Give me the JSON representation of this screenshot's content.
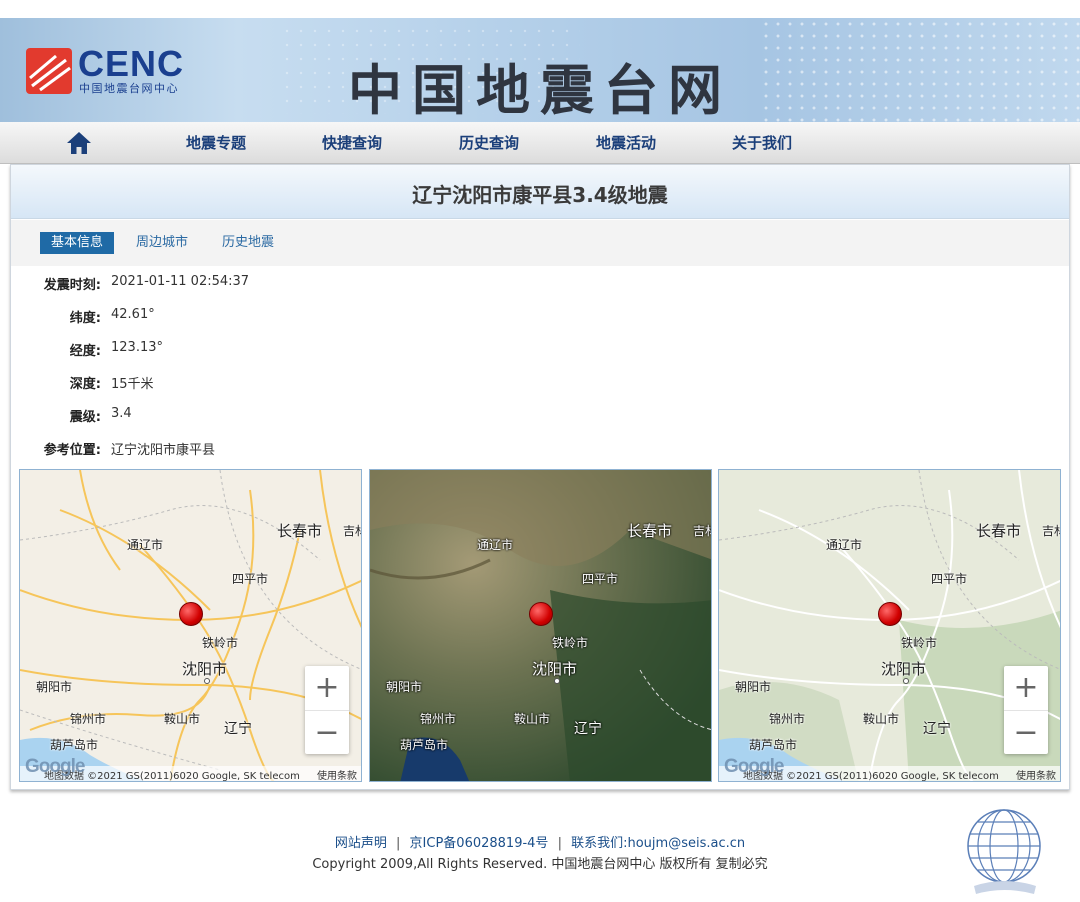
{
  "brand": {
    "logo_text": "CENC",
    "logo_subtitle": "中国地震台网中心",
    "site_title": "中国地震台网"
  },
  "nav": {
    "home_icon": "home-icon",
    "items": [
      "地震专题",
      "快捷查询",
      "历史查询",
      "地震活动",
      "关于我们"
    ]
  },
  "event": {
    "title": "辽宁沈阳市康平县3.4级地震"
  },
  "tabs": {
    "items": [
      "基本信息",
      "周边城市",
      "历史地震"
    ],
    "active": "基本信息"
  },
  "details": [
    {
      "label": "发震时刻:",
      "value": "2021-01-11 02:54:37"
    },
    {
      "label": "纬度:",
      "value": "42.61°"
    },
    {
      "label": "经度:",
      "value": "123.13°"
    },
    {
      "label": "深度:",
      "value": "15千米"
    },
    {
      "label": "震级:",
      "value": "3.4"
    },
    {
      "label": "参考位置:",
      "value": "辽宁沈阳市康平县"
    }
  ],
  "maps": {
    "cities": {
      "changchun": "长春市",
      "jilin": "吉林",
      "tongliao": "通辽市",
      "siping": "四平市",
      "tieling": "铁岭市",
      "shenyang": "沈阳市",
      "chaoyang": "朝阳市",
      "jinzhou": "锦州市",
      "anshan": "鞍山市",
      "liaoning": "辽宁",
      "huludao": "葫芦岛市"
    },
    "zoom_in": "+",
    "zoom_out": "−",
    "google_logo": "Google",
    "attribution": "地图数据 ©2021 GS(2011)6020 Google, SK telecom",
    "terms": "使用条款",
    "types": [
      "road",
      "satellite",
      "terrain"
    ]
  },
  "footer": {
    "links": [
      "网站声明",
      "京ICP备06028819-4号",
      "联系我们:houjm@seis.ac.cn"
    ],
    "separator": "|",
    "copyright": "Copyright 2009,All Rights Reserved. 中国地震台网中心 版权所有 复制必究"
  },
  "colors": {
    "nav_text": "#1b3f7a",
    "tab_active_bg": "#1f6aa6",
    "quake_marker": "#d10000",
    "header_bg": "#b6d1ea"
  }
}
